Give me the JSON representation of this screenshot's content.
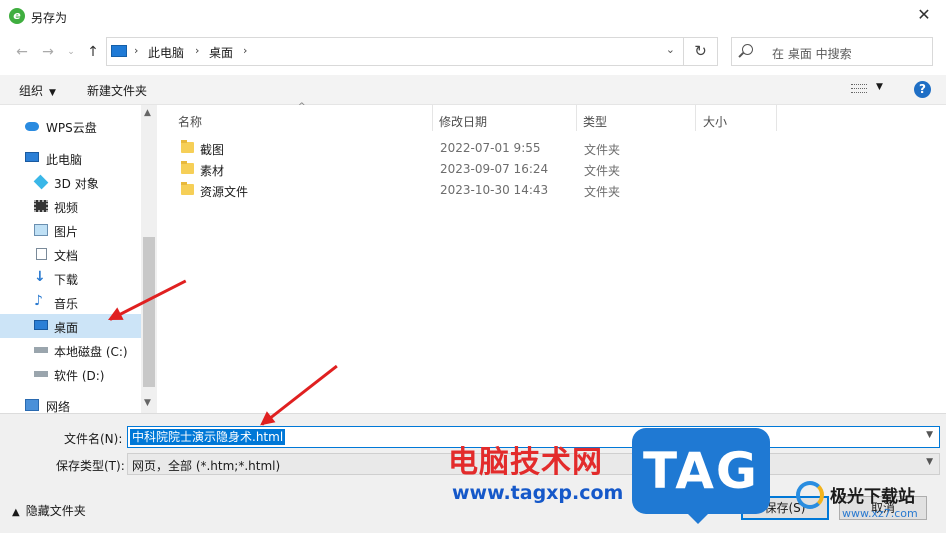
{
  "window": {
    "title": "另存为",
    "close": "✕"
  },
  "nav": {
    "back": "←",
    "forward": "→",
    "up": "↑",
    "breadcrumb": [
      "此电脑",
      "桌面"
    ],
    "refresh": "↻",
    "search_placeholder": "在 桌面 中搜索"
  },
  "toolbar": {
    "organize": "组织",
    "new_folder": "新建文件夹",
    "help": "?"
  },
  "sidebar": {
    "items": [
      {
        "label": "WPS云盘",
        "icon": "cloud-icon"
      },
      {
        "label": "此电脑",
        "icon": "computer-icon"
      },
      {
        "label": "3D 对象",
        "icon": "3d-objects-icon"
      },
      {
        "label": "视频",
        "icon": "video-icon"
      },
      {
        "label": "图片",
        "icon": "pictures-icon"
      },
      {
        "label": "文档",
        "icon": "documents-icon"
      },
      {
        "label": "下载",
        "icon": "download-icon"
      },
      {
        "label": "音乐",
        "icon": "music-icon"
      },
      {
        "label": "桌面",
        "icon": "desktop-icon",
        "selected": true
      },
      {
        "label": "本地磁盘 (C:)",
        "icon": "drive-icon"
      },
      {
        "label": "软件 (D:)",
        "icon": "drive-icon"
      },
      {
        "label": "网络",
        "icon": "network-icon"
      }
    ]
  },
  "filelist": {
    "columns": [
      "名称",
      "修改日期",
      "类型",
      "大小"
    ],
    "rows": [
      {
        "name": "截图",
        "date": "2022-07-01 9:55",
        "type": "文件夹"
      },
      {
        "name": "素材",
        "date": "2023-09-07 16:24",
        "type": "文件夹"
      },
      {
        "name": "资源文件",
        "date": "2023-10-30 14:43",
        "type": "文件夹"
      }
    ]
  },
  "form": {
    "filename_label": "文件名(N):",
    "filename_value": "中科院院士演示隐身术.html",
    "filetype_label": "保存类型(T):",
    "filetype_value": "网页，全部 (*.htm;*.html)",
    "hide_folders": "隐藏文件夹",
    "save": "保存(S)",
    "cancel": "取消"
  },
  "watermark": {
    "cn": "电脑技术网",
    "url": "www.tagxp.com",
    "tag": "TAG",
    "site_name": "极光下载站",
    "site_url": "www.xz7.com"
  },
  "colors": {
    "accent": "#0078d7",
    "selected_bg": "#cce4f7",
    "annotation_arrow": "#e02020",
    "folder": "#f6cf57"
  }
}
